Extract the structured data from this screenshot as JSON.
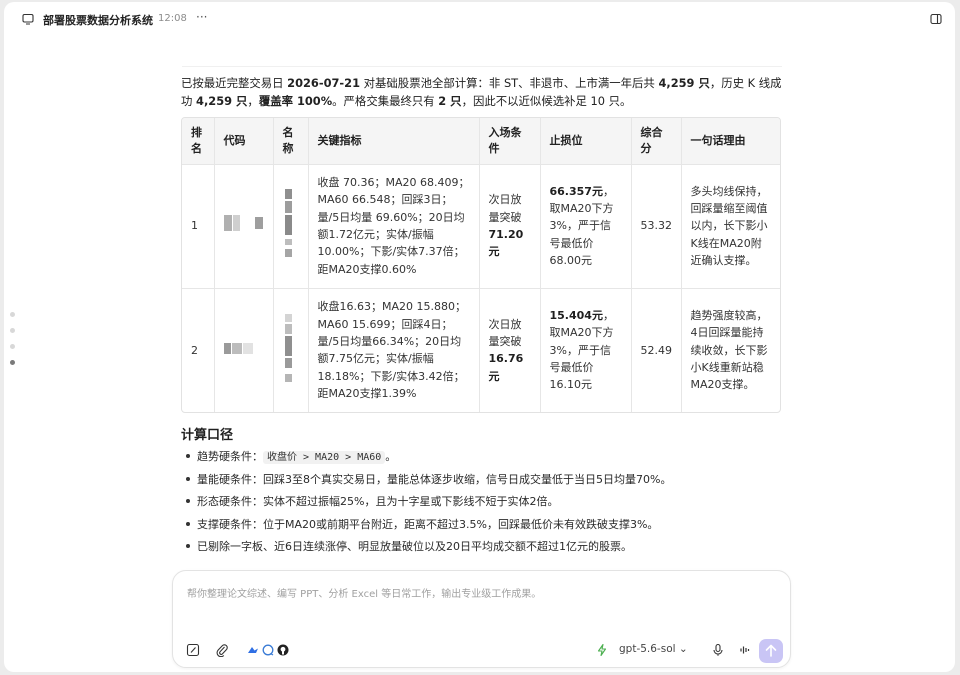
{
  "window": {
    "title": "部署股票数据分析系统",
    "time": "12:08",
    "more": "···"
  },
  "intro": {
    "p1": "已按最近完整交易日 ",
    "date": "2026-07-21",
    "p2": " 对基础股票池全部计算：非 ST、非退市、上市满一年后共 ",
    "pool": "4,259 只",
    "p3": "，历史 K 线成功 ",
    "success": "4,259 只",
    "p4": "，",
    "coverage": "覆盖率 100%",
    "p5": "。严格交集最终只有 ",
    "final": "2 只",
    "p6": "，因此不以近似候选补足 10 只。"
  },
  "table": {
    "headers": {
      "rank": "排名",
      "code": "代码",
      "name": "名称",
      "metrics": "关键指标",
      "entry": "入场条件",
      "stop": "止损位",
      "score": "综合分",
      "reason": "一句话理由"
    },
    "rows": [
      {
        "rank": "1",
        "metrics": "收盘 70.36；MA20 68.409；MA60 66.548；回踩3日；量/5日均量 69.60%；20日均额1.72亿元；实体/振幅10.00%；下影/实体7.37倍；距MA20支撑0.60%",
        "entry_pre": "次日放量突破",
        "entry_price": "71.20元",
        "stop_price": "66.357元",
        "stop_suffix": "，",
        "stop_desc": "取MA20下方3%，严于信号最低价68.00元",
        "score": "53.32",
        "reason": "多头均线保持，回踩量缩至阈值以内，长下影小K线在MA20附近确认支撑。"
      },
      {
        "rank": "2",
        "metrics": "收盘16.63；MA20 15.880；MA60 15.699；回踩4日；量/5日均量66.34%；20日均额7.75亿元；实体/振幅18.18%；下影/实体3.42倍；距MA20支撑1.39%",
        "entry_pre": "次日放量突破",
        "entry_price": "16.76元",
        "stop_price": "15.404元",
        "stop_suffix": "，",
        "stop_desc": "取MA20下方3%，严于信号最低价16.10元",
        "score": "52.49",
        "reason": "趋势强度较高，4日回踩量能持续收敛，长下影小K线重新站稳MA20支撑。"
      }
    ]
  },
  "section": {
    "title": "计算口径",
    "bullets": [
      {
        "pre": "趋势硬条件：",
        "code": "收盘价 > MA20 > MA60",
        "post": "。"
      },
      {
        "pre": "量能硬条件：回踩3至8个真实交易日，量能总体逐步收缩，信号日成交量低于当日5日均量70%。",
        "code": "",
        "post": ""
      },
      {
        "pre": "形态硬条件：实体不超过振幅25%，且为十字星或下影线不短于实体2倍。",
        "code": "",
        "post": ""
      },
      {
        "pre": "支撑硬条件：位于MA20或前期平台附近，距离不超过3.5%，回踩最低价未有效跌破支撑3%。",
        "code": "",
        "post": ""
      },
      {
        "pre": "已剔除一字板、近6日连续涨停、明显放量破位以及20日平均成交额不超过1亿元的股票。",
        "code": "",
        "post": ""
      }
    ]
  },
  "composer": {
    "placeholder": "帮你整理论文综述、编写 PPT、分析 Excel 等日常工作，输出专业级工作成果。",
    "model": "gpt-5.6-sol",
    "model_chevron": "⌄"
  },
  "colors": {
    "accent": "#c9c5f5",
    "header_bg": "#f5f5f5",
    "lightning": "#4caf50"
  }
}
